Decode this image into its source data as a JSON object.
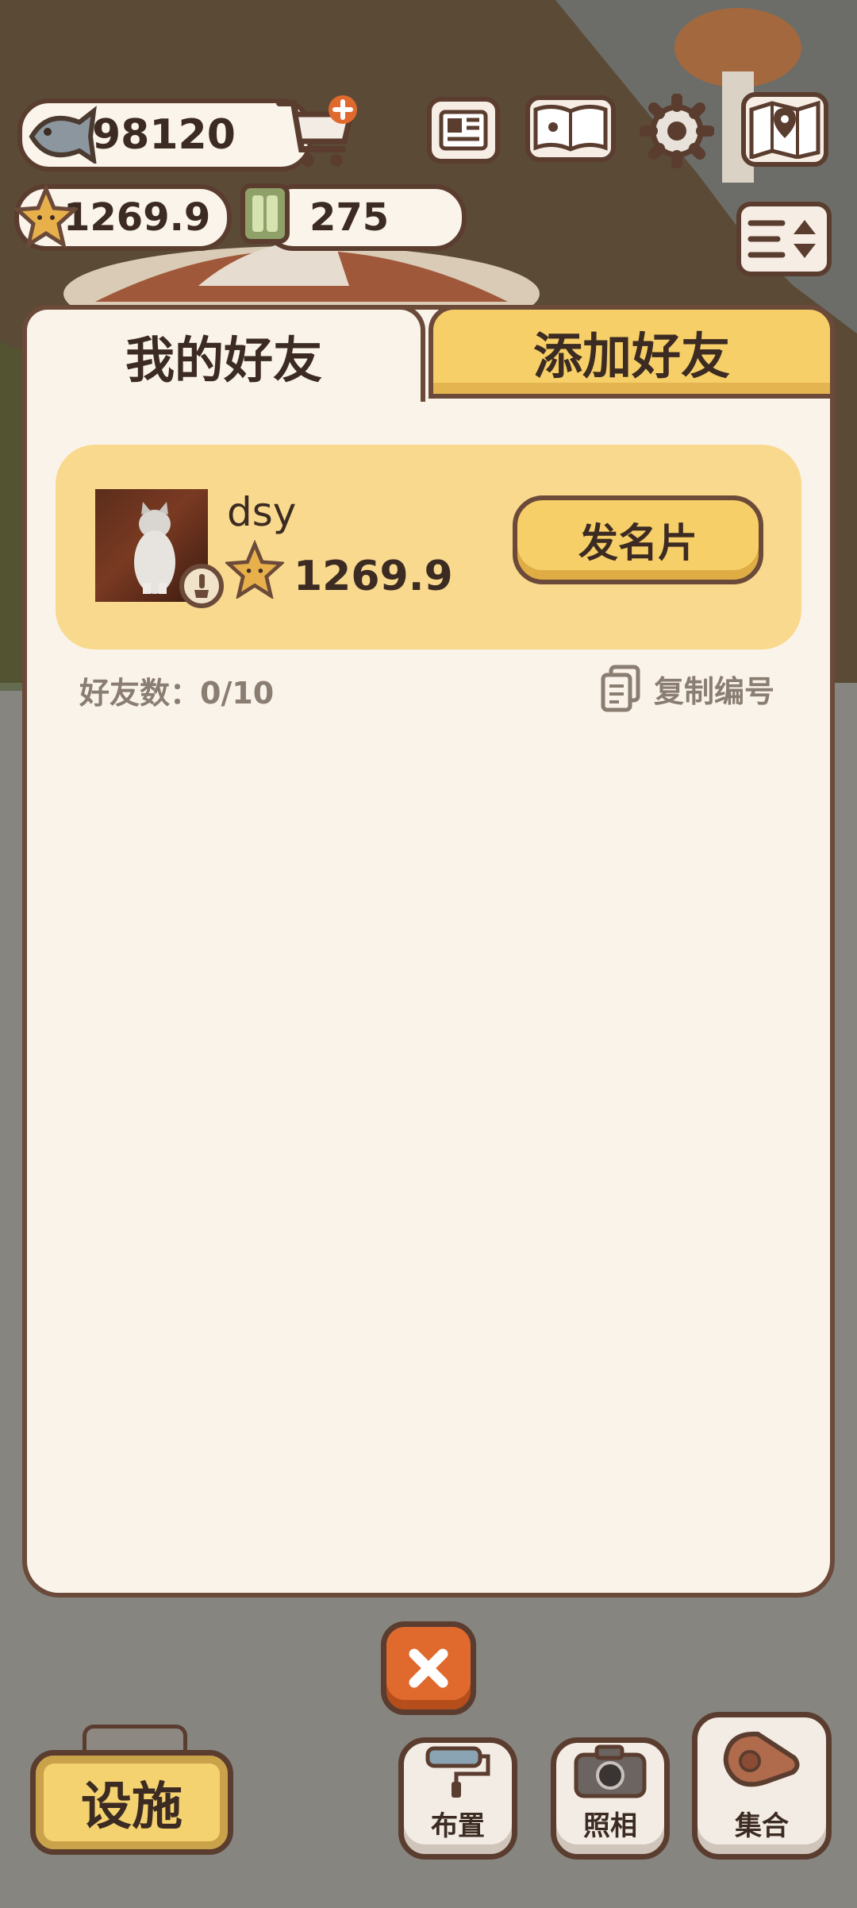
{
  "hud": {
    "fish": "98120",
    "stars": "1269.9",
    "tickets": "275"
  },
  "tabs": {
    "my_friends": "我的好友",
    "add_friend": "添加好友"
  },
  "profile": {
    "name": "dsy",
    "score": "1269.9",
    "send_card_label": "发名片"
  },
  "friend_count": "好友数：0/10",
  "copy_id_label": "复制编号",
  "bottom": {
    "facility": "设施",
    "arrange": "布置",
    "photo": "照相",
    "gather": "集合"
  },
  "colors": {
    "accent_yellow": "#f7cf68",
    "card_yellow": "#f8d98e",
    "panel": "#faf3ea",
    "outline": "#6b4a3a",
    "close_orange": "#e06a2d"
  }
}
